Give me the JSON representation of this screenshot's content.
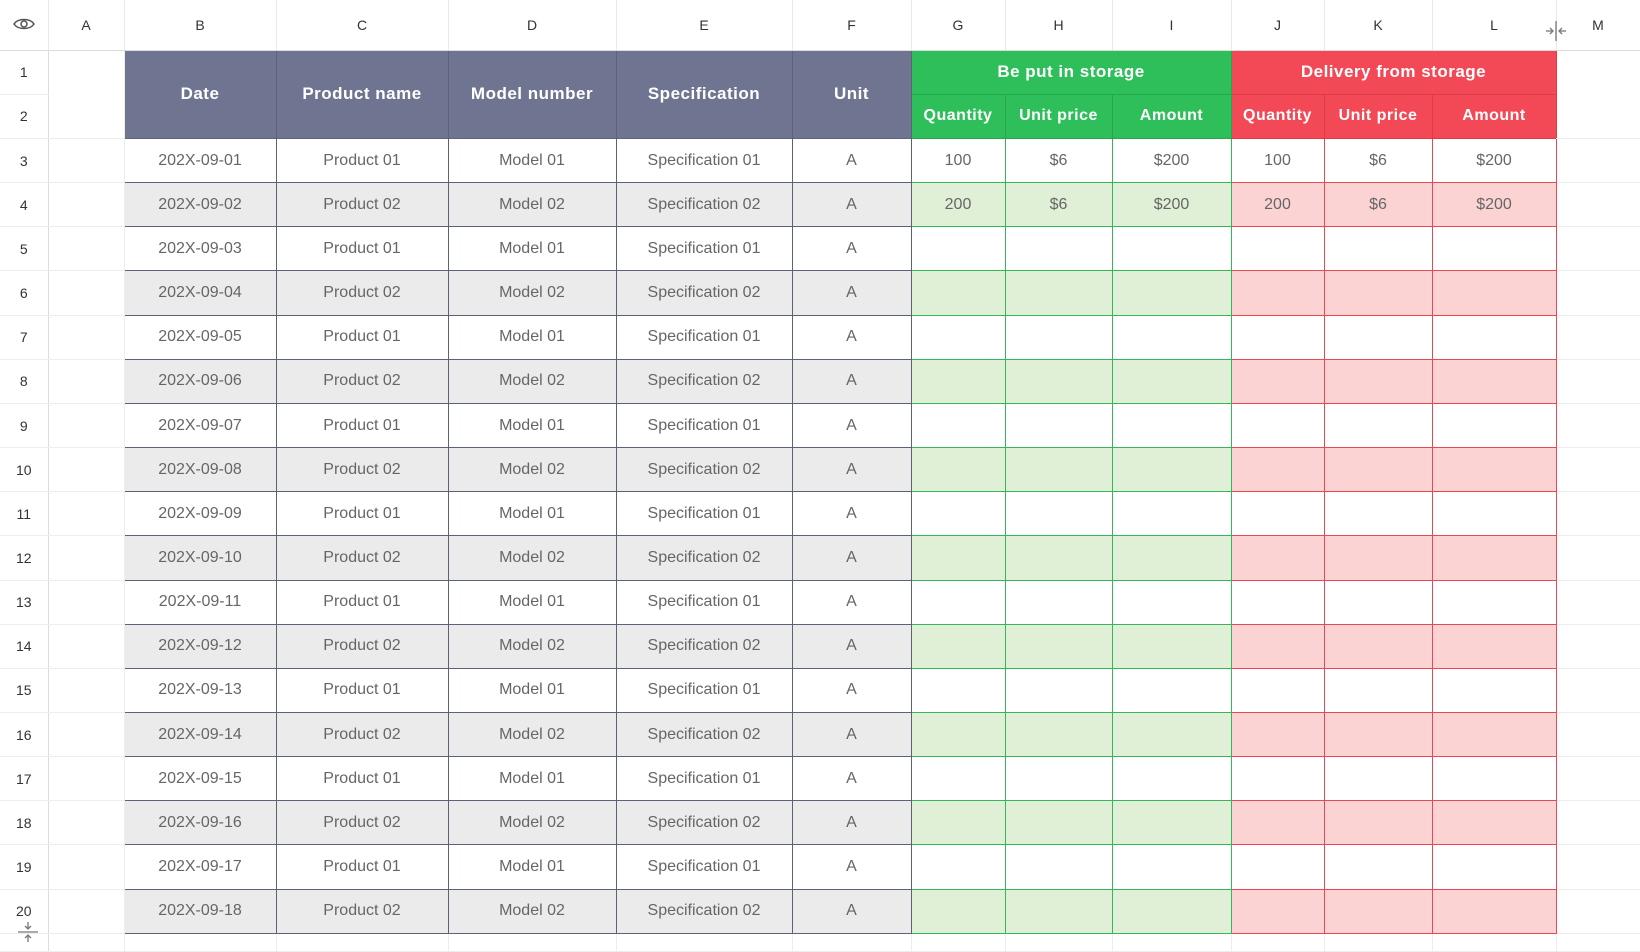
{
  "columns": [
    "A",
    "B",
    "C",
    "D",
    "E",
    "F",
    "G",
    "H",
    "I",
    "J",
    "K",
    "L",
    "M"
  ],
  "row_numbers": [
    "1",
    "2",
    "3",
    "4",
    "5",
    "6",
    "7",
    "8",
    "9",
    "10",
    "11",
    "12",
    "13",
    "14",
    "15",
    "16",
    "17",
    "18",
    "19",
    "20"
  ],
  "header": {
    "date": "Date",
    "product_name": "Product name",
    "model_number": "Model number",
    "specification": "Specification",
    "unit": "Unit",
    "storage_in": "Be put in storage",
    "storage_out": "Delivery from storage",
    "quantity": "Quantity",
    "unit_price": "Unit price",
    "amount": "Amount"
  },
  "rows": [
    {
      "date": "202X-09-01",
      "product": "Product 01",
      "model": "Model 01",
      "spec": "Specification 01",
      "unit": "A",
      "in_qty": "100",
      "in_price": "$6",
      "in_amount": "$200",
      "out_qty": "100",
      "out_price": "$6",
      "out_amount": "$200"
    },
    {
      "date": "202X-09-02",
      "product": "Product 02",
      "model": "Model 02",
      "spec": "Specification 02",
      "unit": "A",
      "in_qty": "200",
      "in_price": "$6",
      "in_amount": "$200",
      "out_qty": "200",
      "out_price": "$6",
      "out_amount": "$200"
    },
    {
      "date": "202X-09-03",
      "product": "Product 01",
      "model": "Model 01",
      "spec": "Specification 01",
      "unit": "A"
    },
    {
      "date": "202X-09-04",
      "product": "Product 02",
      "model": "Model 02",
      "spec": "Specification 02",
      "unit": "A"
    },
    {
      "date": "202X-09-05",
      "product": "Product 01",
      "model": "Model 01",
      "spec": "Specification 01",
      "unit": "A"
    },
    {
      "date": "202X-09-06",
      "product": "Product 02",
      "model": "Model 02",
      "spec": "Specification 02",
      "unit": "A"
    },
    {
      "date": "202X-09-07",
      "product": "Product 01",
      "model": "Model 01",
      "spec": "Specification 01",
      "unit": "A"
    },
    {
      "date": "202X-09-08",
      "product": "Product 02",
      "model": "Model 02",
      "spec": "Specification 02",
      "unit": "A"
    },
    {
      "date": "202X-09-09",
      "product": "Product 01",
      "model": "Model 01",
      "spec": "Specification 01",
      "unit": "A"
    },
    {
      "date": "202X-09-10",
      "product": "Product 02",
      "model": "Model 02",
      "spec": "Specification 02",
      "unit": "A"
    },
    {
      "date": "202X-09-11",
      "product": "Product 01",
      "model": "Model 01",
      "spec": "Specification 01",
      "unit": "A"
    },
    {
      "date": "202X-09-12",
      "product": "Product 02",
      "model": "Model 02",
      "spec": "Specification 02",
      "unit": "A"
    },
    {
      "date": "202X-09-13",
      "product": "Product 01",
      "model": "Model 01",
      "spec": "Specification 01",
      "unit": "A"
    },
    {
      "date": "202X-09-14",
      "product": "Product 02",
      "model": "Model 02",
      "spec": "Specification 02",
      "unit": "A"
    },
    {
      "date": "202X-09-15",
      "product": "Product 01",
      "model": "Model 01",
      "spec": "Specification 01",
      "unit": "A"
    },
    {
      "date": "202X-09-16",
      "product": "Product 02",
      "model": "Model 02",
      "spec": "Specification 02",
      "unit": "A"
    },
    {
      "date": "202X-09-17",
      "product": "Product 01",
      "model": "Model 01",
      "spec": "Specification 01",
      "unit": "A"
    },
    {
      "date": "202X-09-18",
      "product": "Product 02",
      "model": "Model 02",
      "spec": "Specification 02",
      "unit": "A"
    }
  ],
  "colors": {
    "header_gray": "#6f7590",
    "header_green": "#2fbf5a",
    "header_red": "#f34856",
    "stripe_gray": "#ebebeb",
    "stripe_green": "#dff0d6",
    "stripe_red": "#fbd3d3"
  },
  "icons": {
    "corner": "eye-icon",
    "freeze_columns": "freeze-columns-icon",
    "freeze_rows": "freeze-rows-icon"
  }
}
